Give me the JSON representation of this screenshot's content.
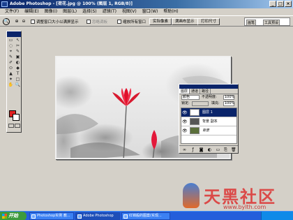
{
  "window": {
    "title": "Adobe Photoshop - [荷花.jpg @ 100% (图层 1, RGB/8)]",
    "buttons": [
      "_",
      "□",
      "×"
    ]
  },
  "menu": [
    "文件(F)",
    "编辑(E)",
    "图像(I)",
    "图层(L)",
    "选择(S)",
    "滤镜(T)",
    "视图(V)",
    "窗口(W)",
    "帮助(H)"
  ],
  "options": {
    "resize_label": "调整窗口大小以满屏显示",
    "ignore_palettes_label": "忽略调板",
    "zoom_all_label": "缩放所有窗口",
    "btn_actual": "实际像素",
    "btn_fit": "满画布显示",
    "btn_print": "打印尺寸",
    "tab_brushes": "画笔",
    "tab_presets": "工具预设"
  },
  "tools": [
    "▭",
    "↖",
    "◌",
    "✂",
    "⌖",
    "✎",
    "✎",
    "▣",
    "✐",
    "◐",
    "⬭",
    "◆",
    "▲",
    "T",
    "✦",
    "□",
    "✋",
    "🔍"
  ],
  "colors": {
    "foreground": "#e02020",
    "background": "#ffffff"
  },
  "layers_panel": {
    "tabs": [
      "图层",
      "通道",
      "路径"
    ],
    "blend_mode": "颜色",
    "opacity_label": "不透明度:",
    "opacity_value": "100%",
    "lock_label": "锁定:",
    "fill_label": "填充:",
    "fill_value": "100%",
    "layers": [
      {
        "name": "图层 1",
        "selected": true
      },
      {
        "name": "背景 副本",
        "selected": false
      },
      {
        "name": "背景",
        "selected": false
      }
    ]
  },
  "watermark": {
    "text": "天黑社区",
    "url": "www.bylth.com"
  },
  "taskbar": {
    "start": "开始",
    "tasks": [
      "Photoshop实例 教...",
      "Adobe Photoshop",
      "红锦般的图案(实现..."
    ]
  }
}
